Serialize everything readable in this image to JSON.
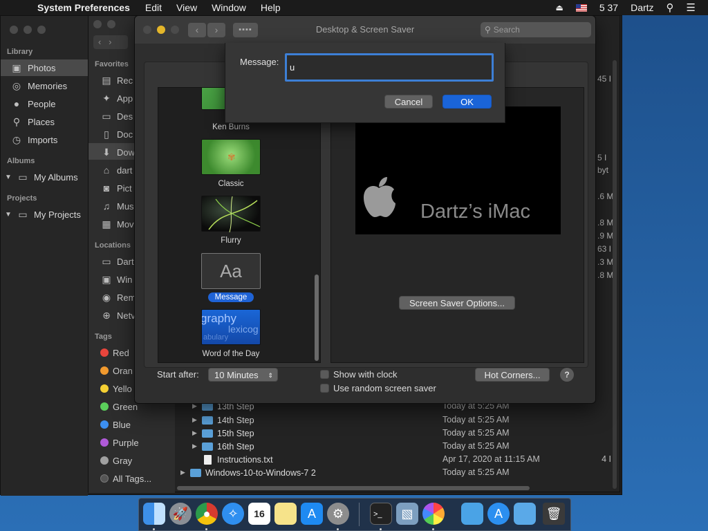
{
  "menubar": {
    "app": "System Preferences",
    "menus": [
      "Edit",
      "View",
      "Window",
      "Help"
    ],
    "clock": "5 37",
    "user": "Dartz"
  },
  "photos": {
    "library_head": "Library",
    "library_items": [
      "Photos",
      "Memories",
      "People",
      "Places",
      "Imports"
    ],
    "albums_head": "Albums",
    "albums_item": "My Albums",
    "projects_head": "Projects",
    "projects_item": "My Projects"
  },
  "finder": {
    "favorites_head": "Favorites",
    "favorites": [
      "Rec",
      "App",
      "Des",
      "Doc",
      "Dow",
      "dart",
      "Pict",
      "Mus",
      "Mov"
    ],
    "locations_head": "Locations",
    "locations": [
      "Dart",
      "Win",
      "Rem",
      "Netv"
    ],
    "tags_head": "Tags",
    "tags": [
      {
        "label": "Red",
        "color": "#e8453c"
      },
      {
        "label": "Oran",
        "color": "#f29a2e"
      },
      {
        "label": "Yello",
        "color": "#f5d033"
      },
      {
        "label": "Green",
        "color": "#5bcf5b"
      },
      {
        "label": "Blue",
        "color": "#3c8ff0"
      },
      {
        "label": "Purple",
        "color": "#b05ad8"
      },
      {
        "label": "Gray",
        "color": "#a0a0a0"
      },
      {
        "label": "All Tags...",
        "color": "#555555"
      }
    ],
    "right_fragments": [
      "45 I",
      "5 I",
      "byt",
      ".6 M",
      ".8 M",
      ".9 M",
      "63 I",
      ".3 M",
      ".8 M"
    ],
    "rows": [
      {
        "name": "13th Step",
        "date": "Today at 5:25 AM",
        "size": ""
      },
      {
        "name": "14th Step",
        "date": "Today at 5:25 AM",
        "size": ""
      },
      {
        "name": "15th Step",
        "date": "Today at 5:25 AM",
        "size": ""
      },
      {
        "name": "16th Step",
        "date": "Today at 5:25 AM",
        "size": ""
      },
      {
        "name": "Instructions.txt",
        "date": "Apr 17, 2020 at 11:15 AM",
        "size": "4 I"
      },
      {
        "name": "Windows-10-to-Windows-7 2",
        "date": "Today at 5:25 AM",
        "size": ""
      }
    ]
  },
  "prefs": {
    "title": "Desktop & Screen Saver",
    "search_placeholder": "Search",
    "savers": [
      "Ken Burns",
      "Classic",
      "Flurry",
      "Message",
      "Word of the Day"
    ],
    "message_thumb_text": "Aa",
    "word_thumb_words": [
      "graphy",
      "lexicog",
      "abulary"
    ],
    "preview_text": "Dartz’s iMac",
    "options_button": "Screen Saver Options...",
    "start_after_label": "Start after:",
    "start_after_value": "10 Minutes",
    "show_clock": "Show with clock",
    "random_saver": "Use random screen saver",
    "hot_corners": "Hot Corners...",
    "help": "?"
  },
  "sheet": {
    "label": "Message:",
    "value": "u",
    "cancel": "Cancel",
    "ok": "OK"
  }
}
